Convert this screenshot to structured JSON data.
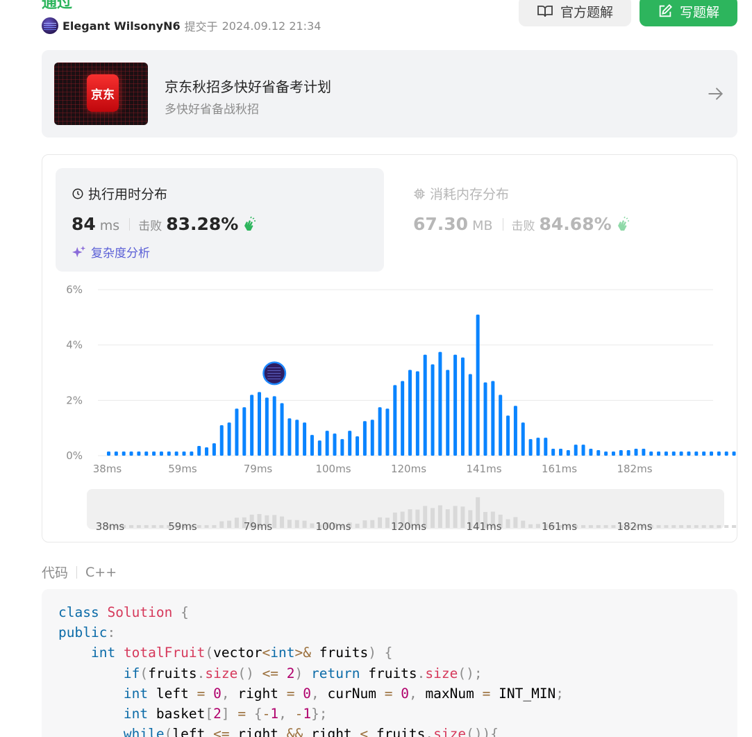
{
  "header": {
    "status": "通过",
    "username": "Elegant WilsonyN6",
    "submit_label": "提交于",
    "submit_time": "2024.09.12 21:34",
    "official_solution_label": "官方题解",
    "write_solution_label": "写题解"
  },
  "promo": {
    "logo_text": "京东",
    "title": "京东秋招多快好省备考计划",
    "subtitle": "多快好省备战秋招"
  },
  "runtime": {
    "title": "执行用时分布",
    "value": "84",
    "unit": "ms",
    "beat_label": "击败",
    "beat_pct": "83.28%",
    "complexity_label": "复杂度分析"
  },
  "memory": {
    "title": "消耗内存分布",
    "value": "67.30",
    "unit": "MB",
    "beat_label": "击败",
    "beat_pct": "84.68%"
  },
  "chart_data": {
    "type": "bar",
    "ylim": [
      0,
      6
    ],
    "y_ticks": [
      "0%",
      "2%",
      "4%",
      "6%"
    ],
    "x_tick_labels": [
      "38ms",
      "59ms",
      "79ms",
      "100ms",
      "120ms",
      "141ms",
      "161ms",
      "182ms"
    ],
    "grid": true,
    "values": [
      0.15,
      0.15,
      0.15,
      0.15,
      0.15,
      0.15,
      0.15,
      0.15,
      0.15,
      0.15,
      0.15,
      0.15,
      0.35,
      0.3,
      0.45,
      1.1,
      1.2,
      1.7,
      1.75,
      2.2,
      2.3,
      2.1,
      2.15,
      1.9,
      1.35,
      1.3,
      1.2,
      0.75,
      0.55,
      0.9,
      0.8,
      0.6,
      0.9,
      0.7,
      1.25,
      1.3,
      1.75,
      1.7,
      2.55,
      2.7,
      3.1,
      3.05,
      3.65,
      3.3,
      3.75,
      3.1,
      3.65,
      3.55,
      2.95,
      5.1,
      2.65,
      2.7,
      2.2,
      1.45,
      1.8,
      1.2,
      0.6,
      0.65,
      0.65,
      0.25,
      0.25,
      0.2,
      0.4,
      0.4,
      0.25,
      0.2,
      0.15,
      0.15,
      0.2,
      0.2,
      0.25,
      0.25,
      0.15,
      0.15,
      0.15,
      0.15,
      0.15,
      0.15,
      0.15,
      0.15,
      0.15,
      0.15,
      0.15,
      0.15,
      0.15
    ],
    "highlight_index": 22,
    "bar_color": "#0a84ff",
    "overview_bar_color": "#d9d9d9"
  },
  "code_section": {
    "label": "代码",
    "language": "C++",
    "lines": [
      [
        [
          "kw",
          "class "
        ],
        [
          "cls",
          "Solution"
        ],
        [
          "p",
          " {"
        ]
      ],
      [
        [
          "kw",
          "public"
        ],
        [
          "p",
          ":"
        ]
      ],
      [
        [
          "t",
          "    "
        ],
        [
          "kw",
          "int "
        ],
        [
          "fn",
          "totalFruit"
        ],
        [
          "p",
          "("
        ],
        [
          "t",
          "vector"
        ],
        [
          "op",
          "<"
        ],
        [
          "kw",
          "int"
        ],
        [
          "op",
          ">&"
        ],
        [
          "t",
          " fruits"
        ],
        [
          "p",
          ") {"
        ]
      ],
      [
        [
          "t",
          "        "
        ],
        [
          "kw",
          "if"
        ],
        [
          "p",
          "("
        ],
        [
          "t",
          "fruits"
        ],
        [
          "p",
          "."
        ],
        [
          "fn",
          "size"
        ],
        [
          "p",
          "() "
        ],
        [
          "op",
          "<="
        ],
        [
          "t",
          " "
        ],
        [
          "num",
          "2"
        ],
        [
          "p",
          ") "
        ],
        [
          "kw",
          "return"
        ],
        [
          "t",
          " fruits"
        ],
        [
          "p",
          "."
        ],
        [
          "fn",
          "size"
        ],
        [
          "p",
          "();"
        ]
      ],
      [
        [
          "t",
          "        "
        ],
        [
          "kw",
          "int "
        ],
        [
          "t",
          "left "
        ],
        [
          "op",
          "="
        ],
        [
          "t",
          " "
        ],
        [
          "num",
          "0"
        ],
        [
          "p",
          ", "
        ],
        [
          "t",
          "right "
        ],
        [
          "op",
          "="
        ],
        [
          "t",
          " "
        ],
        [
          "num",
          "0"
        ],
        [
          "p",
          ", "
        ],
        [
          "t",
          "curNum "
        ],
        [
          "op",
          "="
        ],
        [
          "t",
          " "
        ],
        [
          "num",
          "0"
        ],
        [
          "p",
          ", "
        ],
        [
          "t",
          "maxNum "
        ],
        [
          "op",
          "="
        ],
        [
          "t",
          " INT_MIN"
        ],
        [
          "p",
          ";"
        ]
      ],
      [
        [
          "t",
          "        "
        ],
        [
          "kw",
          "int "
        ],
        [
          "t",
          "basket"
        ],
        [
          "p",
          "["
        ],
        [
          "num",
          "2"
        ],
        [
          "p",
          "] "
        ],
        [
          "op",
          "="
        ],
        [
          "t",
          " "
        ],
        [
          "p",
          "{"
        ],
        [
          "op",
          "-"
        ],
        [
          "num",
          "1"
        ],
        [
          "p",
          ", "
        ],
        [
          "op",
          "-"
        ],
        [
          "num",
          "1"
        ],
        [
          "p",
          "};"
        ]
      ],
      [
        [
          "t",
          "        "
        ],
        [
          "kw",
          "while"
        ],
        [
          "p",
          "("
        ],
        [
          "t",
          "left "
        ],
        [
          "op",
          "<="
        ],
        [
          "t",
          " right "
        ],
        [
          "op",
          "&&"
        ],
        [
          "t",
          " right "
        ],
        [
          "op",
          "<"
        ],
        [
          "t",
          " fruits"
        ],
        [
          "p",
          "."
        ],
        [
          "fn",
          "size"
        ],
        [
          "p",
          "()){"
        ]
      ]
    ]
  },
  "colors": {
    "accent_green": "#2db55d",
    "kw": "#0b6ba8",
    "cls": "#d6395b",
    "fn": "#d6395b",
    "num": "#b0006c",
    "op": "#9a6e3a",
    "p": "#8c8c8c",
    "t": "#000000"
  },
  "icons": {
    "official_solution": "book-open-icon",
    "write_solution": "edit-icon",
    "promo_arrow": "arrow-right-icon",
    "runtime": "clock-icon",
    "memory": "chip-icon",
    "clap": "clapping-hands-icon",
    "complexity": "sparkle-icon"
  }
}
